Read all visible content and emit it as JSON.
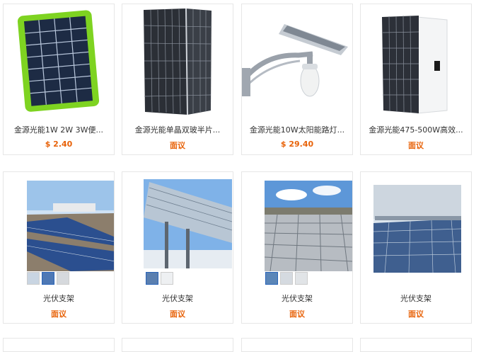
{
  "products": [
    {
      "title": "金源光能1W 2W 3W便...",
      "price": "$ 2.40"
    },
    {
      "title": "金源光能单晶双玻半片...",
      "price": "面议"
    },
    {
      "title": "金源光能10W太阳能路灯...",
      "price": "$ 29.40"
    },
    {
      "title": "金源光能475-500W高效...",
      "price": "面议"
    },
    {
      "title": "光伏支架",
      "price": "面议"
    },
    {
      "title": "光伏支架",
      "price": "面议"
    },
    {
      "title": "光伏支架",
      "price": "面议"
    },
    {
      "title": "光伏支架",
      "price": "面议"
    }
  ],
  "colors": {
    "price": "#e8630a",
    "border": "#e6e6e6"
  }
}
